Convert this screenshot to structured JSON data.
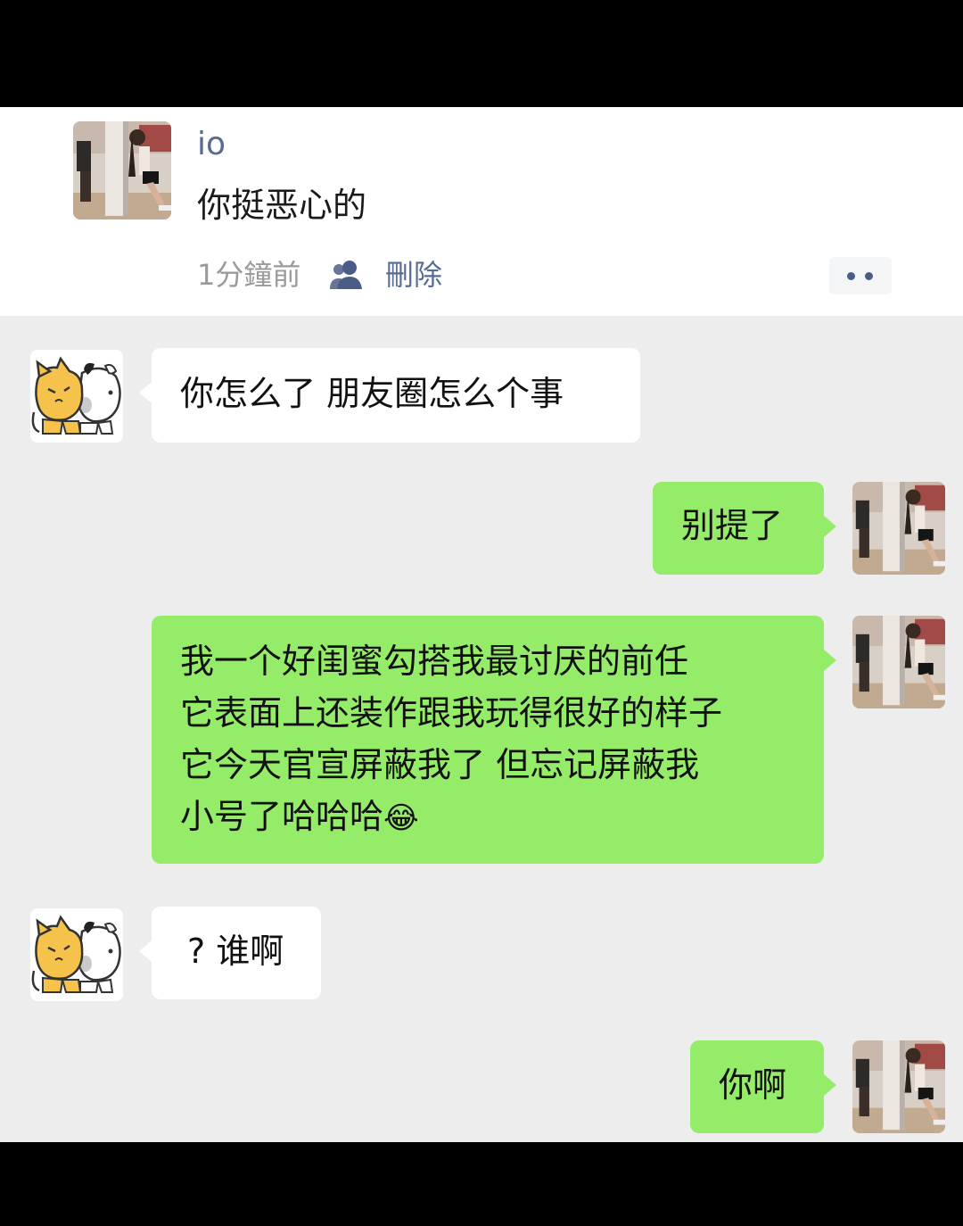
{
  "moment": {
    "author": "io",
    "content": "你挺恶心的",
    "time": "1分鐘前",
    "delete_label": "刪除",
    "privacy_icon": "people-icon",
    "more_icon": "more-dots-icon",
    "avatar_icon": "user-photo-avatar"
  },
  "chat": {
    "messages": [
      {
        "side": "left",
        "avatar": "cat-dog-cartoon-avatar",
        "text": "你怎么了 朋友圈怎么个事"
      },
      {
        "side": "right",
        "avatar": "user-photo-avatar",
        "text": "别提了"
      },
      {
        "side": "right",
        "avatar": "user-photo-avatar",
        "lines": [
          "我一个好闺蜜勾搭我最讨厌的前任",
          "它表面上还装作跟我玩得很好的样子",
          "它今天官宣屏蔽我了 但忘记屏蔽我",
          "小号了哈哈哈"
        ],
        "emoji": "😂",
        "emoji_name": "tears-of-joy-emoji"
      },
      {
        "side": "left",
        "avatar": "cat-dog-cartoon-avatar",
        "text": "? 谁啊"
      },
      {
        "side": "right",
        "avatar": "user-photo-avatar",
        "text": "你啊"
      }
    ]
  },
  "colors": {
    "name_blue": "#576b95",
    "chat_bg": "#ededed",
    "sent_bubble": "#95ec69",
    "received_bubble": "#ffffff"
  }
}
